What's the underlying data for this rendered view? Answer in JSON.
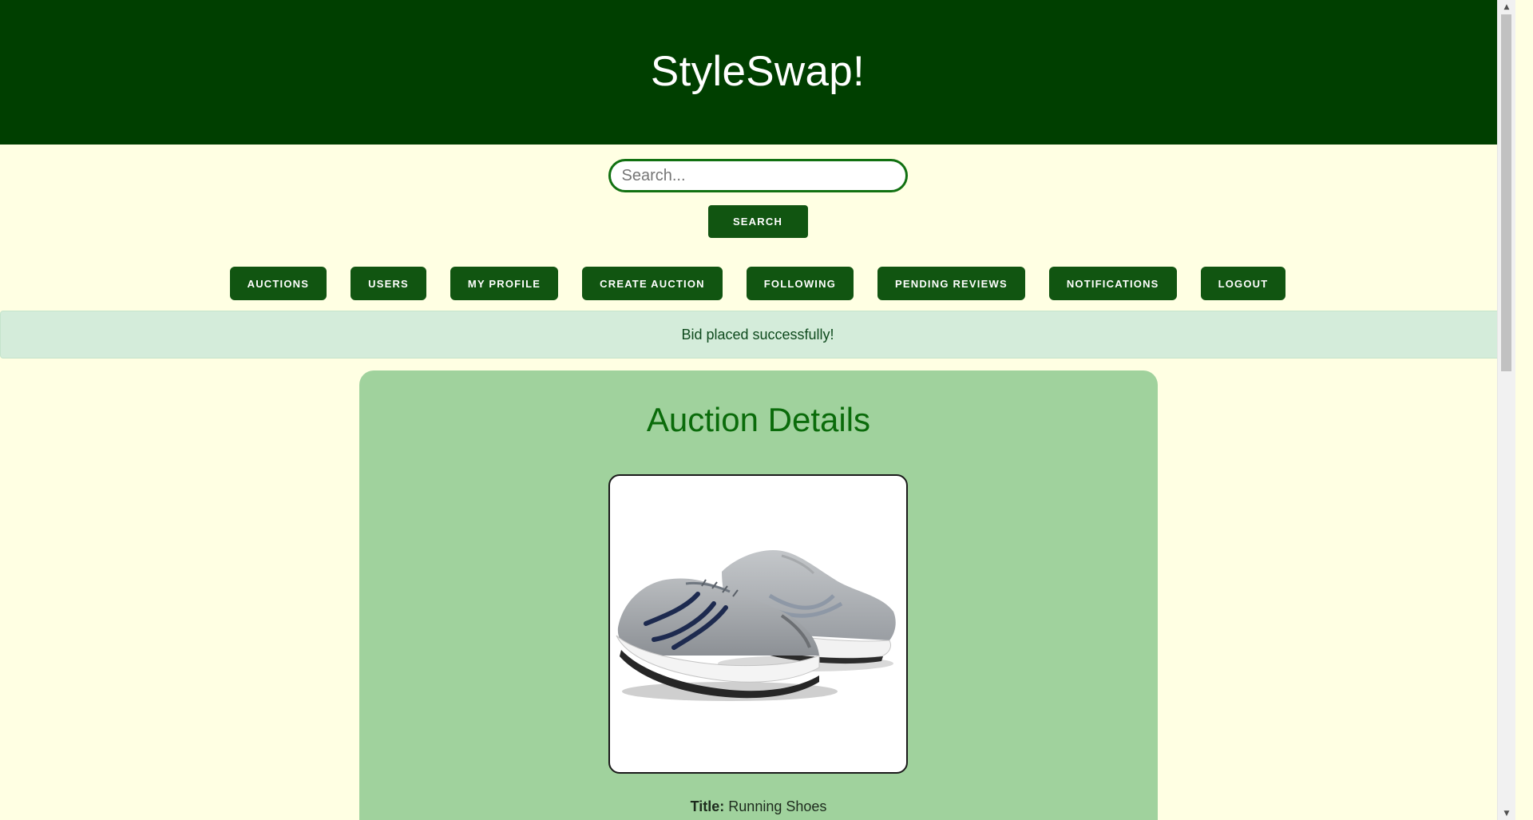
{
  "header": {
    "title": "StyleSwap!"
  },
  "search": {
    "placeholder": "Search...",
    "value": "",
    "button_label": "SEARCH"
  },
  "nav": {
    "items": [
      {
        "label": "AUCTIONS"
      },
      {
        "label": "USERS"
      },
      {
        "label": "MY PROFILE"
      },
      {
        "label": "CREATE AUCTION"
      },
      {
        "label": "FOLLOWING"
      },
      {
        "label": "PENDING REVIEWS"
      },
      {
        "label": "NOTIFICATIONS"
      },
      {
        "label": "LOGOUT"
      }
    ]
  },
  "flash": {
    "message": "Bid placed successfully!"
  },
  "auction": {
    "heading": "Auction Details",
    "image_icon": "running-shoes-image",
    "title_label": "Title:",
    "title_value": "Running Shoes"
  },
  "colors": {
    "header_bg": "#003f00",
    "page_bg": "#ffffe3",
    "button_bg": "#115511",
    "flash_bg": "#d4ecda",
    "card_bg": "#a0d29d",
    "heading": "#0a6b0a"
  }
}
